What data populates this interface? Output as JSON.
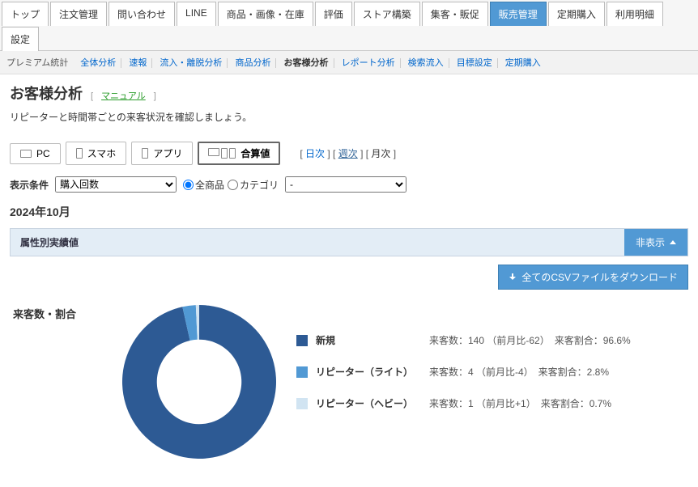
{
  "tabs_main": [
    "トップ",
    "注文管理",
    "問い合わせ",
    "LINE",
    "商品・画像・在庫",
    "評価",
    "ストア構築",
    "集客・販促",
    "販売管理",
    "定期購入",
    "利用明細",
    "設定"
  ],
  "active_main_tab_index": 8,
  "subnav": {
    "label": "プレミアム統計",
    "items": [
      "全体分析",
      "速報",
      "流入・離脱分析",
      "商品分析",
      "お客様分析",
      "レポート分析",
      "検索流入",
      "目標設定",
      "定期購入"
    ],
    "active_index": 4
  },
  "page_title": "お客様分析",
  "manual_label": "マニュアル",
  "description": "リピーターと時間帯ごとの来客状況を確認しましょう。",
  "devices": {
    "pc": "PC",
    "sp": "スマホ",
    "app": "アプリ",
    "sum": "合算値",
    "active_index": 3
  },
  "period": {
    "daily": "日次",
    "weekly": "週次",
    "monthly": "月次",
    "active": "weekly"
  },
  "cond": {
    "label": "表示条件",
    "select_value": "購入回数",
    "radio_all": "全商品",
    "radio_cat": "カテゴリ",
    "radio_selected": "all",
    "cat_select_value": "-"
  },
  "month": "2024年10月",
  "section": {
    "title": "属性別実績値",
    "toggle": "非表示"
  },
  "download_btn": "全てのCSVファイルをダウンロード",
  "chart_title": "来客数・割合",
  "legend_labels": {
    "visitors_prefix": "来客数：",
    "mom_prefix": "（前月比",
    "mom_suffix": "）",
    "ratio_prefix": "来客割合：",
    "pct_suffix": "%"
  },
  "chart_data": {
    "type": "pie",
    "title": "来客数・割合",
    "series": [
      {
        "name": "新規",
        "visitors": 140,
        "mom": -62,
        "ratio_pct": 96.6,
        "color": "#2d5a94"
      },
      {
        "name": "リピーター（ライト）",
        "visitors": 4,
        "mom": -4,
        "ratio_pct": 2.8,
        "color": "#5199d4"
      },
      {
        "name": "リピーター（ヘビー）",
        "visitors": 1,
        "mom": 1,
        "ratio_pct": 0.7,
        "color": "#d1e4f2"
      }
    ],
    "donut_inner_ratio": 0.55
  }
}
